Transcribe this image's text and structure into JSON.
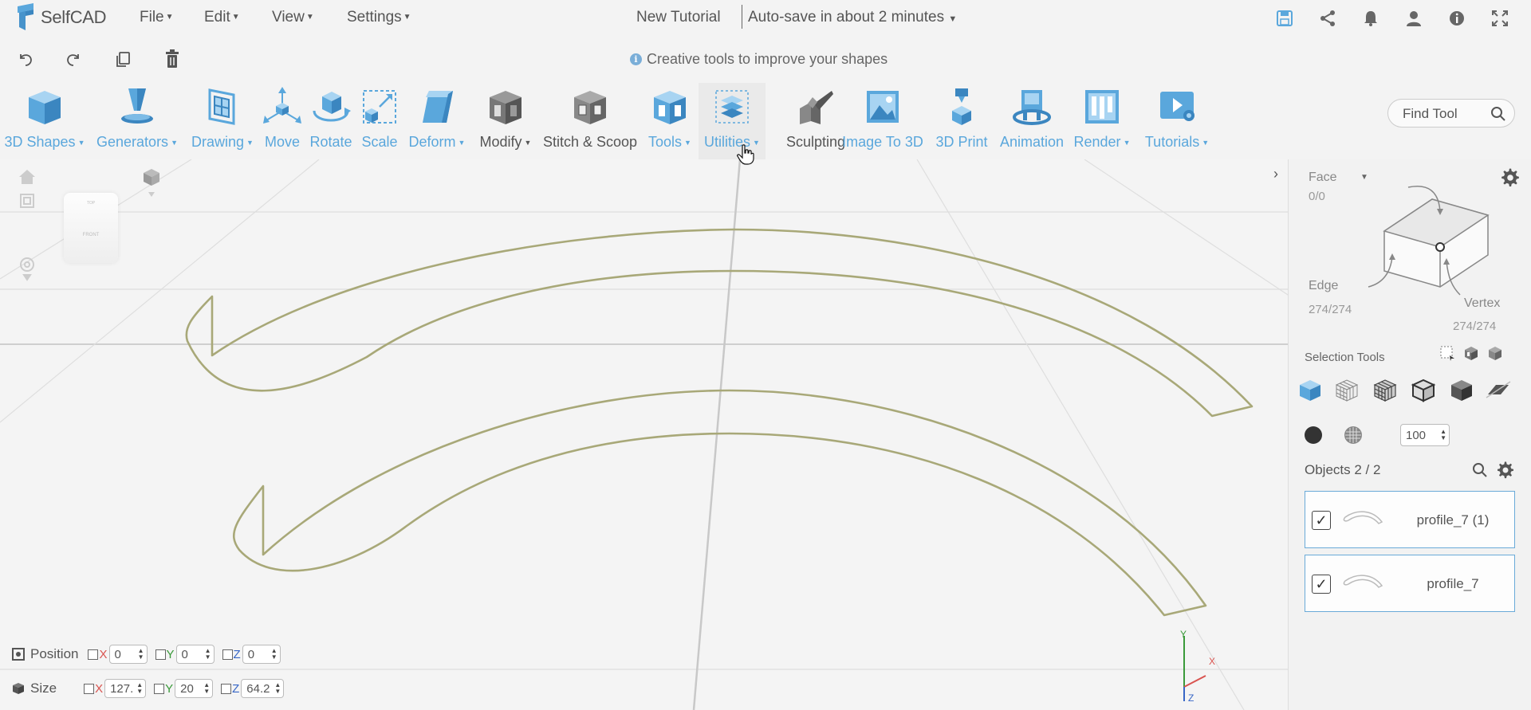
{
  "app": {
    "logo_text": "SelfCAD",
    "menus": [
      "File",
      "Edit",
      "View",
      "Settings"
    ],
    "document_title": "New Tutorial",
    "autosave_text": "Auto-save in about 2 minutes",
    "top_icons": [
      "save-icon",
      "share-icon",
      "bell-icon",
      "user-icon",
      "info-icon",
      "fullscreen-icon"
    ]
  },
  "quickbar": {
    "icons": [
      "undo-icon",
      "redo-icon",
      "copy-icon",
      "trash-icon"
    ],
    "hint": "Creative tools to improve your shapes"
  },
  "toolbar": {
    "tools": [
      {
        "label": "3D Shapes",
        "dropdown": true,
        "style": "blue"
      },
      {
        "label": "Generators",
        "dropdown": true,
        "style": "blue"
      },
      {
        "label": "Drawing",
        "dropdown": true,
        "style": "blue"
      },
      {
        "label": "Move",
        "dropdown": false,
        "style": "blue"
      },
      {
        "label": "Rotate",
        "dropdown": false,
        "style": "blue"
      },
      {
        "label": "Scale",
        "dropdown": false,
        "style": "blue"
      },
      {
        "label": "Deform",
        "dropdown": true,
        "style": "blue"
      },
      {
        "label": "Modify",
        "dropdown": true,
        "style": "dark"
      },
      {
        "label": "Stitch & Scoop",
        "dropdown": false,
        "style": "dark"
      },
      {
        "label": "Tools",
        "dropdown": true,
        "style": "blue"
      },
      {
        "label": "Utilities",
        "dropdown": true,
        "style": "blue"
      },
      {
        "label": "Sculpting",
        "dropdown": false,
        "style": "dark"
      },
      {
        "label": "Image To 3D",
        "dropdown": false,
        "style": "blue"
      },
      {
        "label": "3D Print",
        "dropdown": false,
        "style": "blue"
      },
      {
        "label": "Animation",
        "dropdown": false,
        "style": "blue"
      },
      {
        "label": "Render",
        "dropdown": true,
        "style": "blue"
      },
      {
        "label": "Tutorials",
        "dropdown": true,
        "style": "blue"
      }
    ],
    "find_tool": "Find Tool"
  },
  "viewport": {
    "viewcube_top": "TOP",
    "viewcube_front": "FRONT",
    "position": {
      "label": "Position",
      "x": "0",
      "y": "0",
      "z": "0"
    },
    "size": {
      "label": "Size",
      "x": "127.",
      "y": "20",
      "z": "64.2"
    },
    "axis_labels": {
      "x": "X",
      "y": "Y",
      "z": "Z"
    }
  },
  "rightpanel": {
    "face_label": "Face",
    "face_count": "0/0",
    "edge_label": "Edge",
    "edge_count": "274/274",
    "vertex_label": "Vertex",
    "vertex_count": "274/274",
    "selection_tools_label": "Selection Tools",
    "opacity": "100",
    "objects_label": "Objects 2 / 2",
    "objects": [
      {
        "name": "profile_7 (1)",
        "checked": true
      },
      {
        "name": "profile_7",
        "checked": true
      }
    ]
  },
  "colors": {
    "accent_blue": "#5aa7dc",
    "curve_olive": "#a8a878",
    "selected_border": "#6aaad8"
  }
}
